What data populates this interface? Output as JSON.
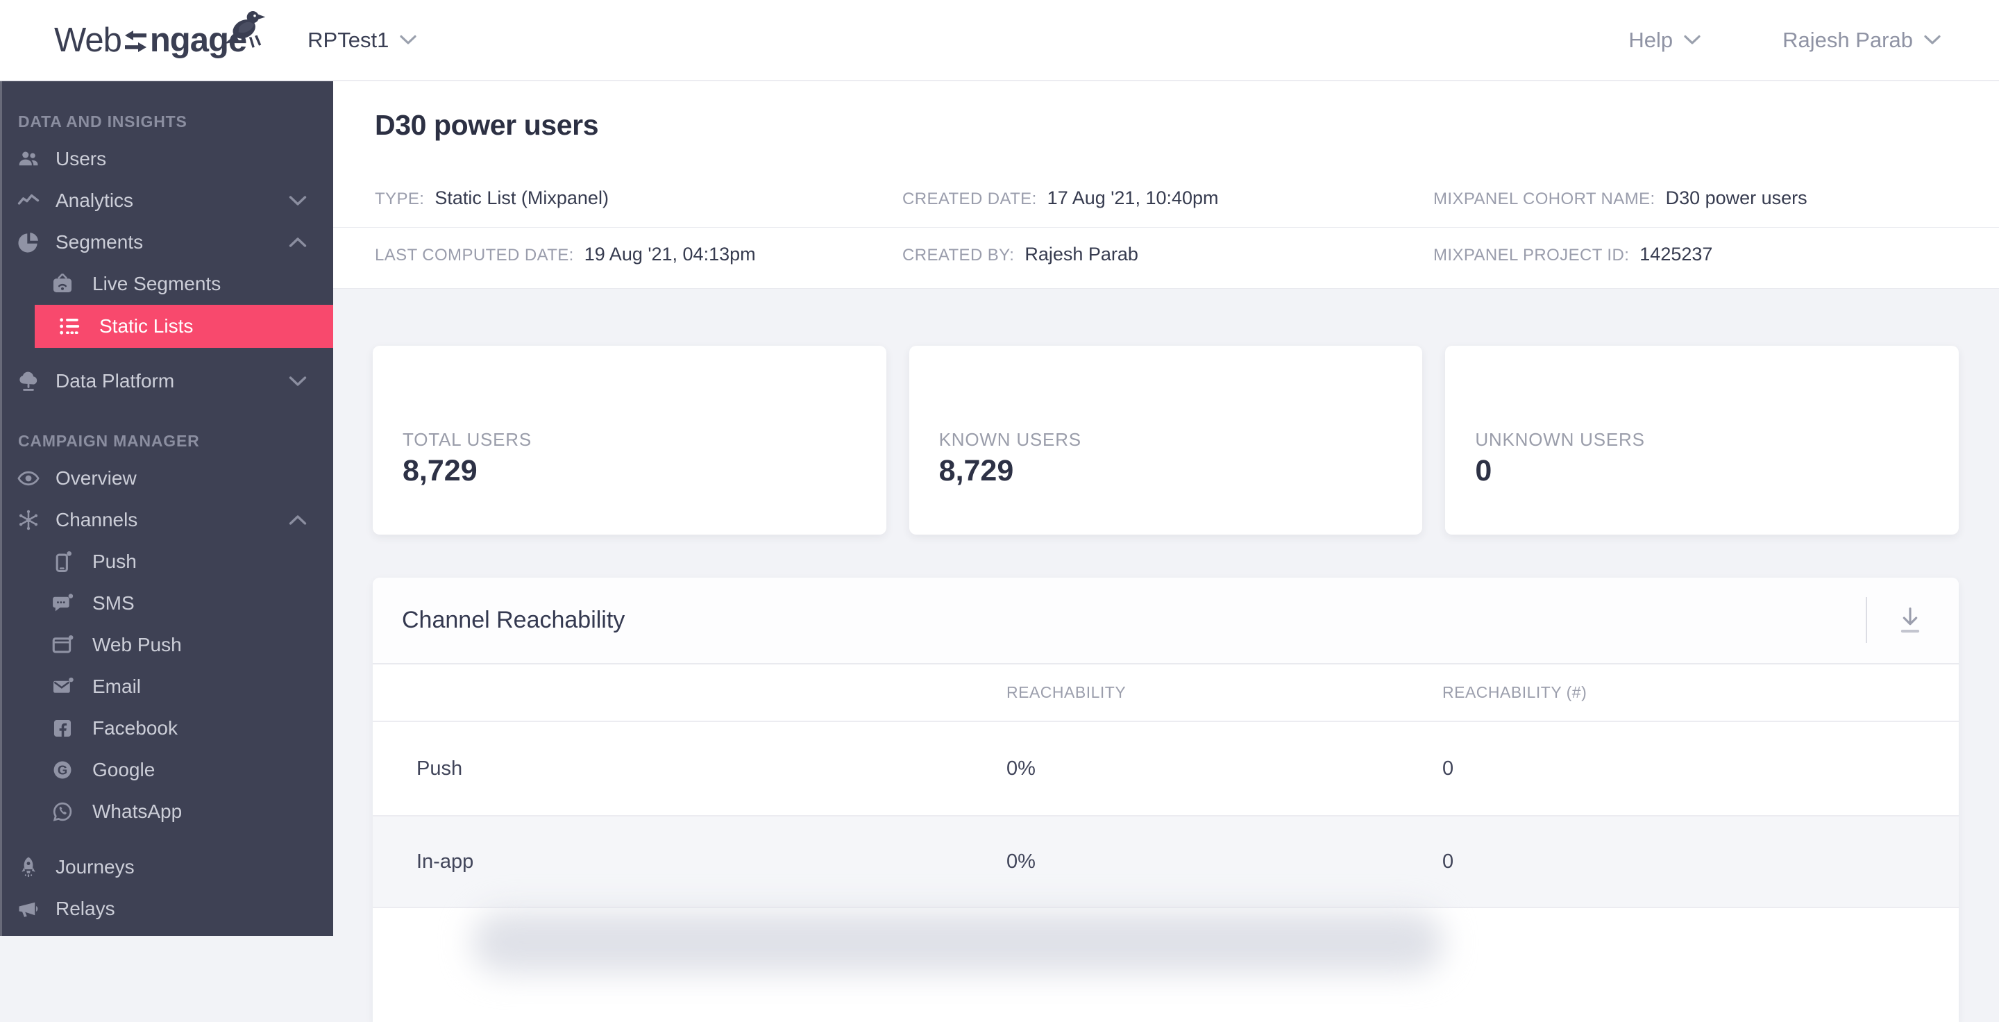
{
  "topbar": {
    "logo_web": "Web",
    "logo_ngage": "ngage",
    "workspace": "RPTest1",
    "help": "Help",
    "user": "Rajesh Parab"
  },
  "sidebar": {
    "section1_title": "DATA AND INSIGHTS",
    "section2_title": "CAMPAIGN MANAGER",
    "items": {
      "users": {
        "label": "Users"
      },
      "analytics": {
        "label": "Analytics"
      },
      "segments": {
        "label": "Segments"
      },
      "live_segments": {
        "label": "Live Segments"
      },
      "static_lists": {
        "label": "Static Lists"
      },
      "data_platform": {
        "label": "Data Platform"
      },
      "overview": {
        "label": "Overview"
      },
      "channels": {
        "label": "Channels"
      },
      "push": {
        "label": "Push"
      },
      "sms": {
        "label": "SMS"
      },
      "web_push": {
        "label": "Web Push"
      },
      "email": {
        "label": "Email"
      },
      "facebook": {
        "label": "Facebook"
      },
      "google": {
        "label": "Google"
      },
      "whatsapp": {
        "label": "WhatsApp"
      },
      "journeys": {
        "label": "Journeys"
      },
      "relays": {
        "label": "Relays"
      }
    }
  },
  "header": {
    "title": "D30 power users",
    "meta": {
      "type_label": "TYPE:",
      "type_value": "Static List (Mixpanel)",
      "created_date_label": "CREATED DATE:",
      "created_date_value": "17 Aug '21, 10:40pm",
      "cohort_label": "MIXPANEL COHORT NAME:",
      "cohort_value": "D30 power users",
      "last_computed_label": "LAST COMPUTED DATE:",
      "last_computed_value": "19 Aug '21, 04:13pm",
      "created_by_label": "CREATED BY:",
      "created_by_value": "Rajesh Parab",
      "project_id_label": "MIXPANEL PROJECT ID:",
      "project_id_value": "1425237"
    }
  },
  "stats": {
    "cards": [
      {
        "label": "TOTAL USERS",
        "value": "8,729"
      },
      {
        "label": "KNOWN USERS",
        "value": "8,729"
      },
      {
        "label": "UNKNOWN USERS",
        "value": "0"
      }
    ]
  },
  "reachability": {
    "title": "Channel Reachability",
    "columns": [
      "REACHABILITY",
      "REACHABILITY (#)"
    ],
    "rows": [
      {
        "channel": "Push",
        "reachability": "0%",
        "count": "0"
      },
      {
        "channel": "In-app",
        "reachability": "0%",
        "count": "0"
      }
    ]
  },
  "colors": {
    "accent_pink": "#f8496d",
    "sidebar_bg": "#3e4154",
    "page_bg": "#f2f3f7",
    "text_dark": "#2c3043",
    "text_gray": "#9a9dac"
  }
}
